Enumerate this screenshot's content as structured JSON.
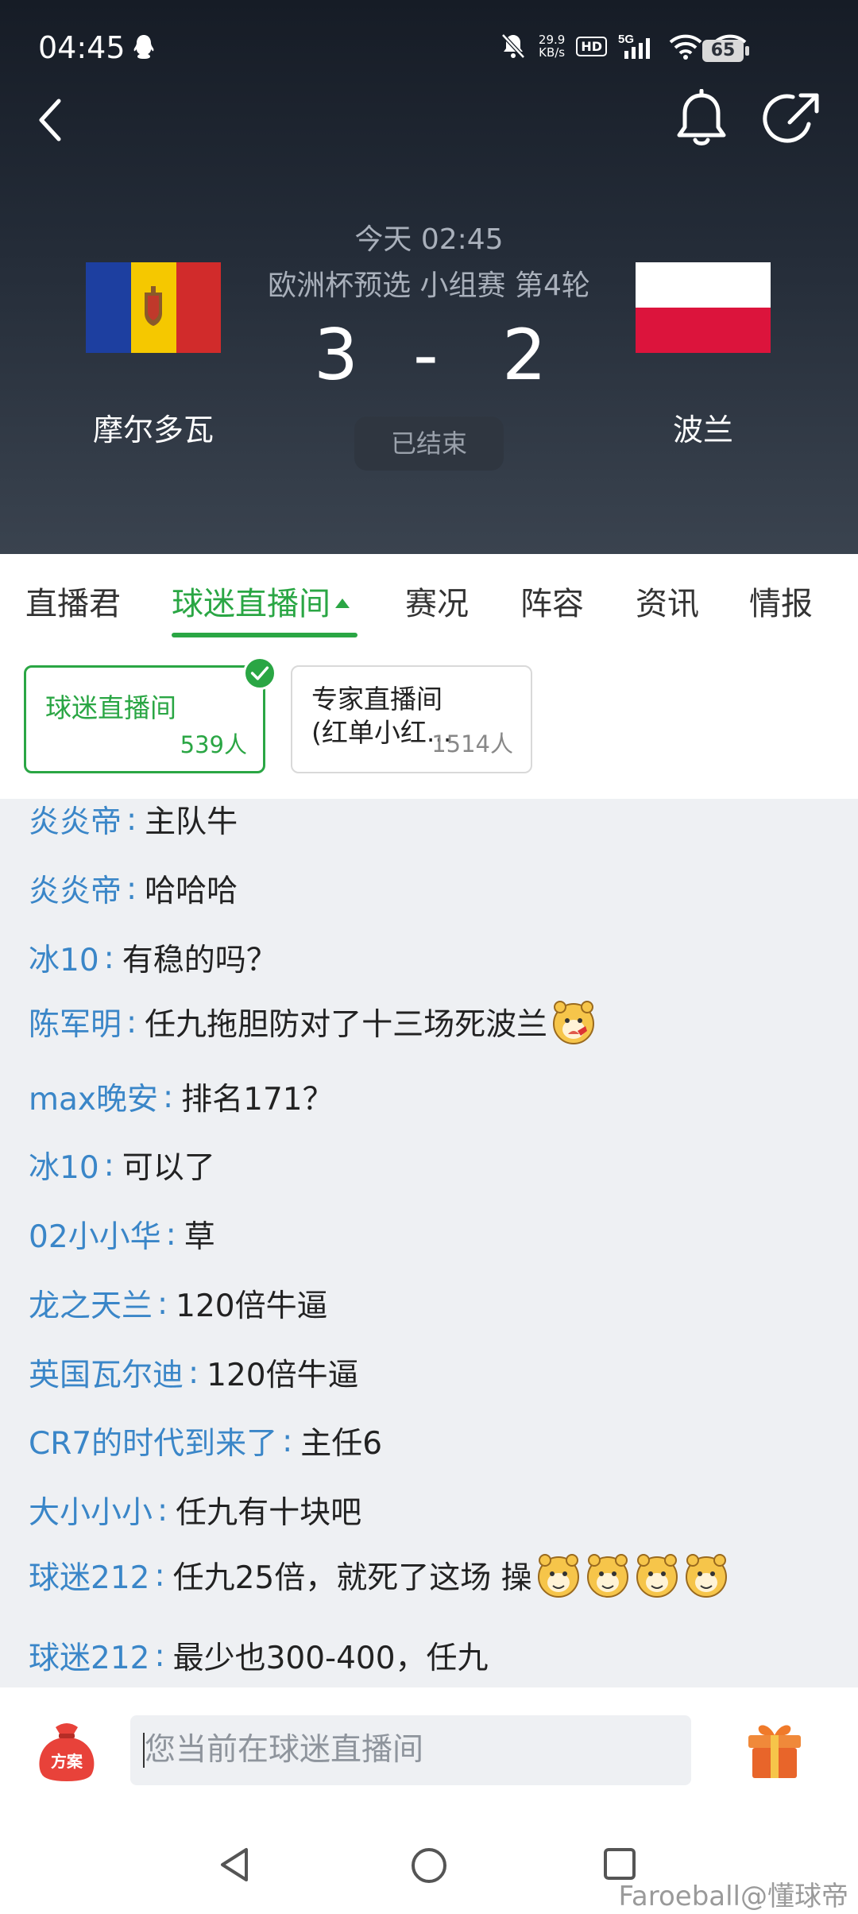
{
  "status_bar": {
    "time": "04:45",
    "net_speed_value": "29.9",
    "net_speed_unit": "KB/s",
    "hd": "HD",
    "network": "5G",
    "battery": "65"
  },
  "match": {
    "time": "今天 02:45",
    "league": "欧洲杯预选 小组赛 第4轮",
    "home_team": "摩尔多瓦",
    "away_team": "波兰",
    "home_score": "3",
    "score_sep": "-",
    "away_score": "2",
    "status": "已结束"
  },
  "tabs": [
    {
      "label": "直播君"
    },
    {
      "label": "球迷直播间"
    },
    {
      "label": "赛况"
    },
    {
      "label": "阵容"
    },
    {
      "label": "资讯"
    },
    {
      "label": "情报"
    }
  ],
  "rooms": [
    {
      "title": "球迷直播间",
      "count": "539人"
    },
    {
      "title": "专家直播间(红单小红...",
      "count": "1514人"
    }
  ],
  "messages": [
    {
      "user": "炎炎帝",
      "text": "主队牛"
    },
    {
      "user": "炎炎帝",
      "text": "哈哈哈"
    },
    {
      "user": "冰10",
      "text": "有稳的吗？"
    },
    {
      "user": "陈军明",
      "text": "任九拖胆防对了十三场死波兰"
    },
    {
      "user": "max晚安",
      "text": "排名171？"
    },
    {
      "user": "冰10",
      "text": "可以了"
    },
    {
      "user": "02小小华",
      "text": "草"
    },
    {
      "user": "龙之天兰",
      "text": "120倍牛逼"
    },
    {
      "user": "英国瓦尔迪",
      "text": "120倍牛逼"
    },
    {
      "user": "CR7的时代到来了",
      "text": "主任6"
    },
    {
      "user": "大小小小",
      "text": "任九有十块吧"
    },
    {
      "user": "球迷212",
      "text": "任九25倍，就死了这场 操"
    },
    {
      "user": "球迷212",
      "text": "最少也300-400，任九"
    }
  ],
  "separator": ":",
  "input": {
    "placeholder": "您当前在球迷直播间",
    "plan_label": "方案"
  },
  "watermark": "Faroeball@懂球帝",
  "colors": {
    "accent": "#2aa644",
    "username": "#3a86c8",
    "header_bg": "#1c232e"
  }
}
